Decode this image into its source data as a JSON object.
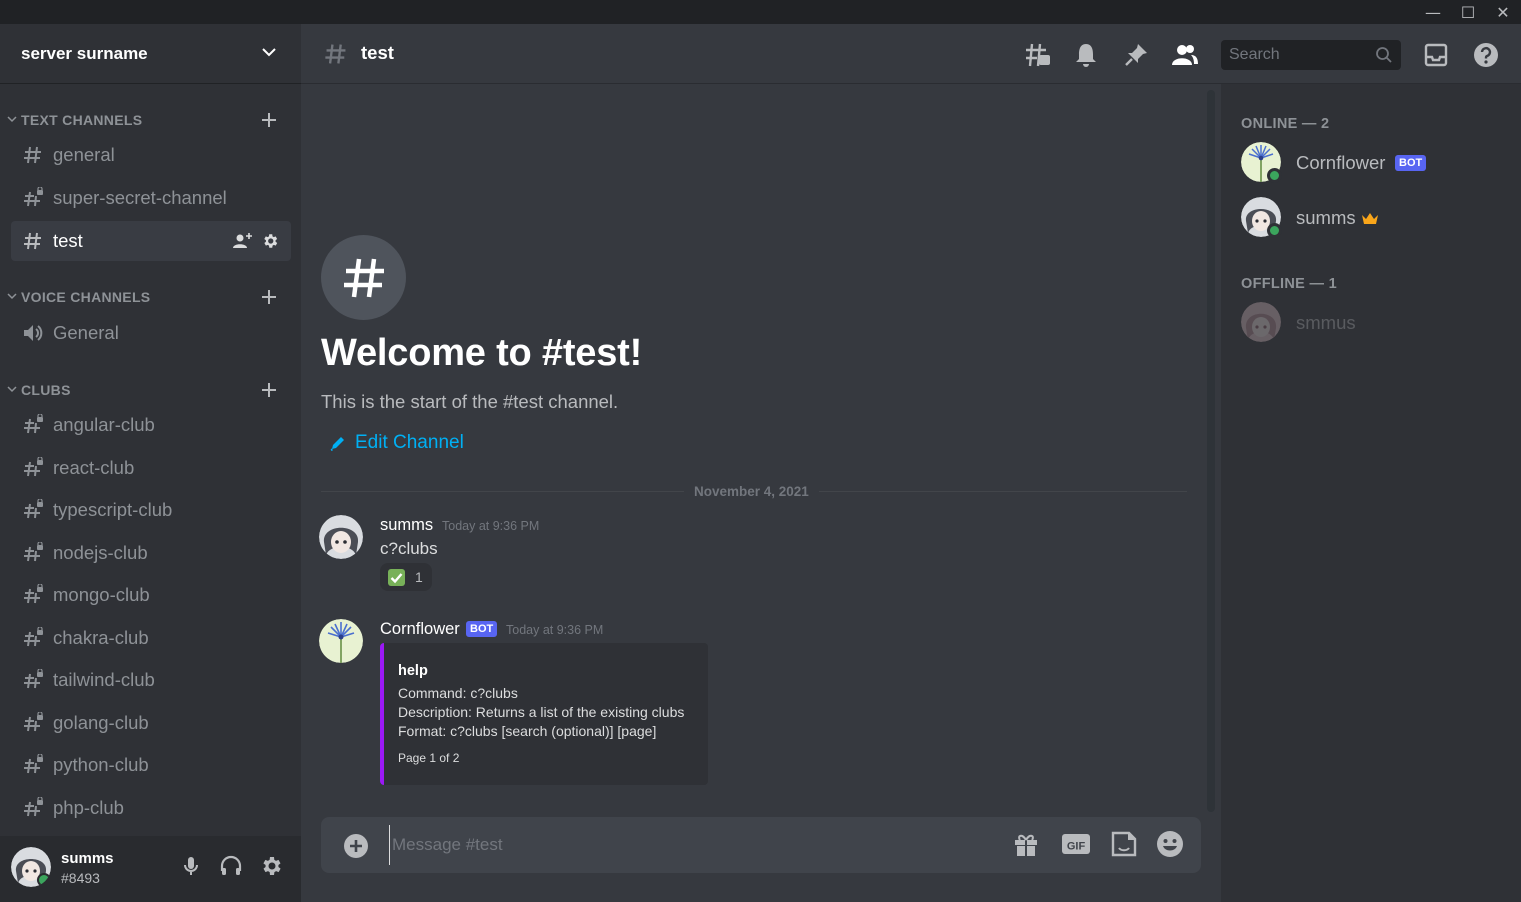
{
  "window": {
    "minimize_glyph": "—",
    "maximize_glyph": "☐",
    "close_glyph": "✕"
  },
  "server": {
    "name": "server surname"
  },
  "sidebar": {
    "categories": [
      {
        "label": "TEXT CHANNELS"
      },
      {
        "label": "VOICE CHANNELS"
      },
      {
        "label": "CLUBS"
      }
    ],
    "text_channels": [
      {
        "name": "general"
      },
      {
        "name": "super-secret-channel"
      },
      {
        "name": "test"
      }
    ],
    "voice_channels": [
      {
        "name": "General"
      }
    ],
    "clubs": [
      {
        "name": "angular-club"
      },
      {
        "name": "react-club"
      },
      {
        "name": "typescript-club"
      },
      {
        "name": "nodejs-club"
      },
      {
        "name": "mongo-club"
      },
      {
        "name": "chakra-club"
      },
      {
        "name": "tailwind-club"
      },
      {
        "name": "golang-club"
      },
      {
        "name": "python-club"
      },
      {
        "name": "php-club"
      }
    ]
  },
  "user_panel": {
    "username": "summs",
    "tag": "#8493"
  },
  "header": {
    "channel_name": "test",
    "search_placeholder": "Search"
  },
  "welcome": {
    "title": "Welcome to #test!",
    "subtitle": "This is the start of the #test channel.",
    "edit_label": "Edit Channel"
  },
  "messages": {
    "date": "November 4, 2021",
    "items": [
      {
        "author": "summs",
        "timestamp": "Today at 9:36 PM",
        "text": "c?clubs",
        "reaction_count": "1"
      },
      {
        "author": "Cornflower",
        "badge": "BOT",
        "timestamp": "Today at 9:36 PM",
        "embed": {
          "title": "help",
          "lines": [
            "Command: c?clubs",
            "Description: Returns a list of the existing clubs",
            "Format: c?clubs [search (optional)] [page]"
          ],
          "footer": "Page 1 of 2",
          "accent_color": "#9b19f5"
        }
      }
    ]
  },
  "composer": {
    "placeholder": "Message #test",
    "gif_label": "GIF"
  },
  "members": {
    "online_label": "ONLINE — 2",
    "offline_label": "OFFLINE — 1",
    "online": [
      {
        "name": "Cornflower",
        "badge": "BOT"
      },
      {
        "name": "summs",
        "crown": true
      }
    ],
    "offline": [
      {
        "name": "smmus"
      }
    ]
  },
  "colors": {
    "accent": "#5865f2",
    "link": "#00b0f4",
    "online": "#3ba55d",
    "crown": "#faa61a"
  }
}
